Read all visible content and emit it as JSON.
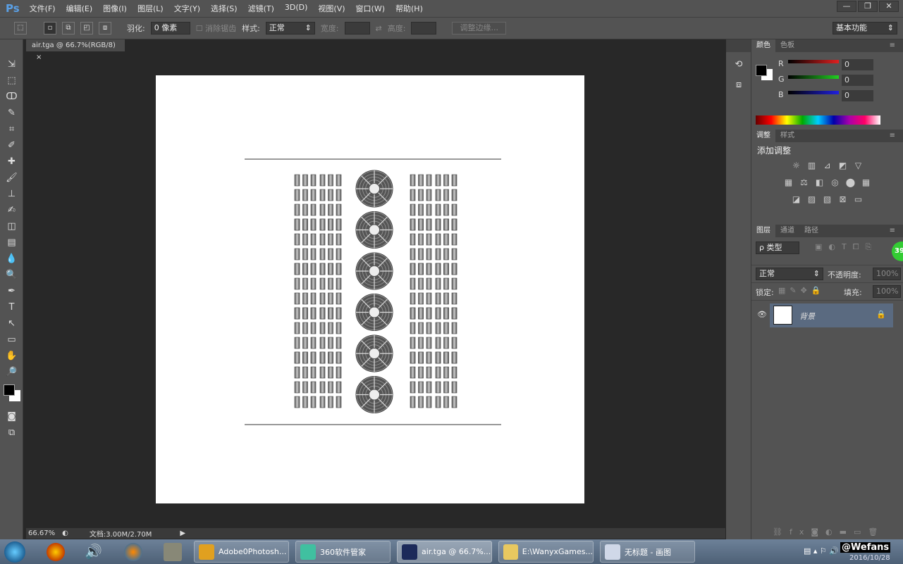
{
  "app": {
    "logo": "Ps",
    "menus": [
      "文件(F)",
      "编辑(E)",
      "图像(I)",
      "图层(L)",
      "文字(Y)",
      "选择(S)",
      "滤镜(T)",
      "3D(D)",
      "视图(V)",
      "窗口(W)",
      "帮助(H)"
    ],
    "window_controls": [
      "—",
      "❐",
      "✕"
    ]
  },
  "options": {
    "feather_label": "羽化:",
    "feather_value": "0 像素",
    "antialias_label": "消除锯齿",
    "style_label": "样式:",
    "style_value": "正常",
    "width_label": "宽度:",
    "height_label": "高度:",
    "refine_edge": "调整边缘...",
    "workspace": "基本功能"
  },
  "document": {
    "tab_title": "air.tga @ 66.7%(RGB/8)",
    "close": "×",
    "zoom": "66.67%",
    "doc_size": "文档:3.00M/2.70M"
  },
  "tools": [
    "⇲",
    "⬚",
    "ↀ",
    "✎",
    "⌗",
    "✐",
    "✚",
    "🖌",
    "⊥",
    "✍",
    "◫",
    "▤",
    "💧",
    "🔍",
    "✒",
    "T",
    "↖",
    "▭",
    "✋",
    "🔎"
  ],
  "color_panel": {
    "tabs": [
      "颜色",
      "色板"
    ],
    "channels": [
      {
        "label": "R",
        "value": "0",
        "color": "#e02020"
      },
      {
        "label": "G",
        "value": "0",
        "color": "#20d020"
      },
      {
        "label": "B",
        "value": "0",
        "color": "#2020e0"
      }
    ],
    "foreground": "#000000",
    "background": "#ffffff"
  },
  "adjust_panel": {
    "tabs": [
      "调整",
      "样式"
    ],
    "title": "添加调整",
    "icons": [
      [
        "☼",
        "▥",
        "⊿",
        "◩",
        "▽"
      ],
      [
        "▦",
        "⚖",
        "◧",
        "◎",
        "⬤",
        "▦"
      ],
      [
        "◪",
        "▨",
        "▧",
        "⊠",
        "▭"
      ]
    ]
  },
  "layers_panel": {
    "tabs": [
      "图层",
      "通道",
      "路径"
    ],
    "filter": "ρ 类型",
    "blend_mode": "正常",
    "opacity_label": "不透明度:",
    "opacity_value": "100%",
    "lock_label": "锁定:",
    "fill_label": "填充:",
    "fill_value": "100%",
    "layers": [
      {
        "name": "背景",
        "visible": true,
        "locked": true
      }
    ],
    "badge": "39"
  },
  "taskbar": {
    "items": [
      {
        "label": "Adobe0Photosh...",
        "color": "#e0a020"
      },
      {
        "label": "360软件管家",
        "color": "#40c0a0"
      },
      {
        "label": "air.tga @ 66.7%...",
        "color": "#1c2a5a"
      },
      {
        "label": "E:\\WanyxGames...",
        "color": "#e8c860"
      },
      {
        "label": "无标题 - 画图",
        "color": "#d0d8e8"
      }
    ],
    "clock_brand": "@Wefans",
    "date": "2016/10/28"
  }
}
